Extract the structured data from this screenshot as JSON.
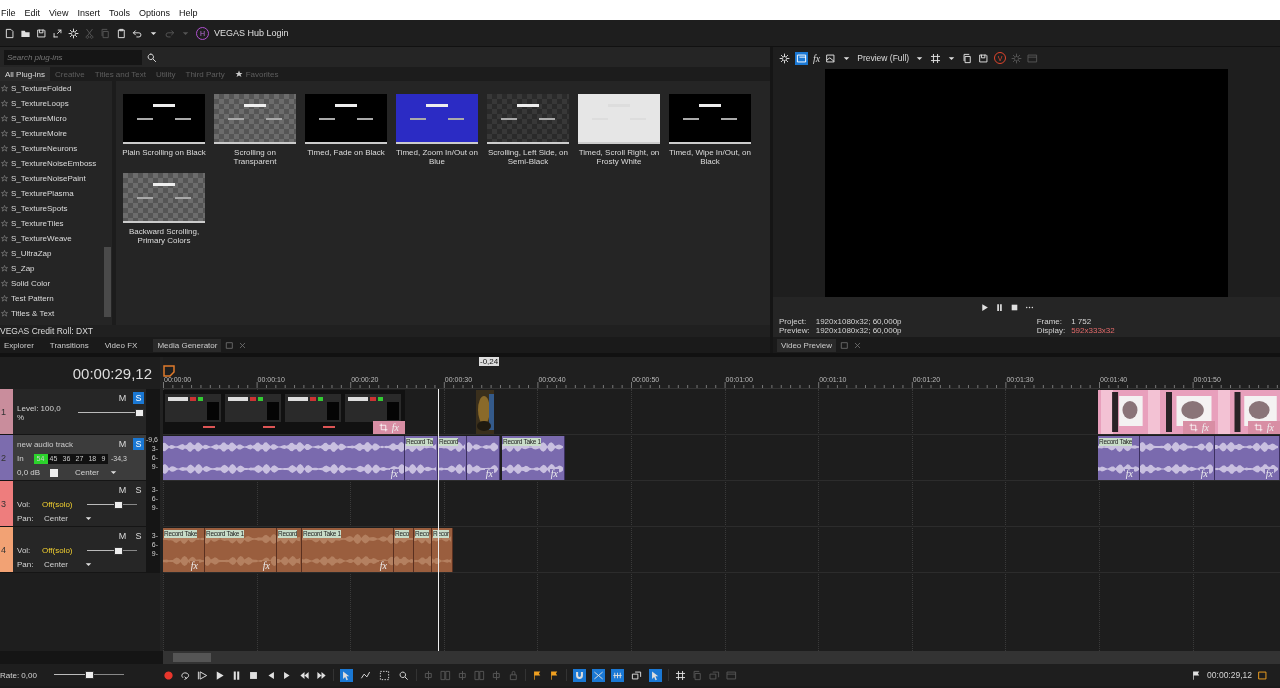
{
  "menu": [
    "File",
    "Edit",
    "View",
    "Insert",
    "Tools",
    "Options",
    "Help"
  ],
  "toolbar": {
    "buttons": [
      {
        "kind": "document",
        "disabled": false
      },
      {
        "kind": "folder",
        "disabled": false
      },
      {
        "kind": "save",
        "disabled": false
      },
      {
        "kind": "expand",
        "disabled": false
      },
      {
        "kind": "settings",
        "disabled": false
      },
      {
        "kind": "scissors",
        "disabled": true
      },
      {
        "kind": "copy",
        "disabled": true
      },
      {
        "kind": "clipboard",
        "disabled": false
      },
      {
        "kind": "undo",
        "disabled": false
      },
      {
        "kind": "caret",
        "disabled": false
      },
      {
        "kind": "redo",
        "disabled": true
      },
      {
        "kind": "caret",
        "disabled": true
      }
    ],
    "hub_badge": "H",
    "hub_label": "VEGAS Hub Login"
  },
  "media_generator": {
    "search": {
      "placeholder": "Search plug-ins"
    },
    "tabs": [
      {
        "label": "All Plug-ins",
        "selected": true
      },
      {
        "label": "Creative",
        "selected": false
      },
      {
        "label": "Titles and Text",
        "selected": false
      },
      {
        "label": "Utility",
        "selected": false
      },
      {
        "label": "Third Party",
        "selected": false
      },
      {
        "label": "Favorites",
        "selected": false
      }
    ],
    "plugins": [
      "S_TextureFolded",
      "S_TextureLoops",
      "S_TextureMicro",
      "S_TextureMoire",
      "S_TextureNeurons",
      "S_TextureNoiseEmboss",
      "S_TextureNoisePaint",
      "S_TexturePlasma",
      "S_TextureSpots",
      "S_TextureTiles",
      "S_TextureWeave",
      "S_UltraZap",
      "S_Zap",
      "Solid Color",
      "Test Pattern",
      "Titles & Text"
    ],
    "presets": [
      {
        "name": "Plain Scrolling on Black",
        "kind": "black"
      },
      {
        "name": "Scrolling on Transparent",
        "kind": "checker"
      },
      {
        "name": "Timed, Fade on Black",
        "kind": "black"
      },
      {
        "name": "Timed, Zoom In/Out on Blue",
        "kind": "blue"
      },
      {
        "name": "Scrolling, Left Side, on Semi-Black",
        "kind": "dark-checker"
      },
      {
        "name": "Timed, Scroll Right, on Frosty White",
        "kind": "white"
      },
      {
        "name": "Timed, Wipe In/Out, on Black",
        "kind": "black"
      },
      {
        "name": "Backward Scrolling, Primary Colors",
        "kind": "checker"
      }
    ],
    "status": "VEGAS Credit Roll: DXT"
  },
  "dock_tabs": [
    {
      "label": "Explorer",
      "selected": false
    },
    {
      "label": "Transitions",
      "selected": false
    },
    {
      "label": "Video FX",
      "selected": false
    },
    {
      "label": "Media Generator",
      "selected": true
    }
  ],
  "preview": {
    "split_view_on": true,
    "fx": "fx",
    "quality": "Preview (Full)",
    "badge": "V",
    "project_label": "Project:",
    "project": "1920x1080x32; 60,000p",
    "preview_label": "Preview:",
    "preview_value": "1920x1080x32; 60,000p",
    "frame_label": "Frame:",
    "frame": "1 752",
    "display_label": "Display:",
    "display": "592x333x32",
    "tab": {
      "label": "Video Preview",
      "selected": true
    }
  },
  "timeline": {
    "time": "00:00:29,12",
    "marker": "-0,24",
    "ruler": [
      "00:00:00",
      "00:00:10",
      "00:00:20",
      "00:00:30",
      "00:00:40",
      "00:00:50",
      "00:01:00",
      "00:01:10",
      "00:01:20",
      "00:01:30",
      "00:01:40",
      "00:01:50"
    ],
    "tracks": [
      {
        "kind": "video",
        "number": "1",
        "color": "#c98d9c",
        "selected": false,
        "mute": "M",
        "solo": "S",
        "solo_on": true,
        "level_label": "Level: 100,0 %",
        "level": 1.0,
        "clips": [
          {
            "kind": "screen",
            "fx": "fx"
          },
          {
            "kind": "painting"
          },
          {
            "kind": "pink"
          },
          {
            "kind": "pink",
            "fx": "fx"
          },
          {
            "kind": "pink",
            "fx": "fx"
          }
        ]
      },
      {
        "kind": "audio-input",
        "number": "2",
        "color": "#7c6cae",
        "selected": true,
        "name": "new audio track",
        "mute": "M",
        "solo": "S",
        "solo_on": true,
        "peak": "-9,6",
        "in_label": "In",
        "meter_ticks": [
          "54",
          "45",
          "36",
          "27",
          "18",
          "9"
        ],
        "meter_reading": "-34,3",
        "level": 0.19,
        "gain": "0,0 dB",
        "pan": "Center",
        "scale": [
          "3-",
          "6-",
          "9-"
        ],
        "clips": [
          {
            "fx": "fx"
          },
          {
            "label": "Record Ta"
          },
          {
            "label": "Record"
          },
          {
            "fx": "fx"
          },
          {
            "label": "Record Take 1",
            "fx": "fx"
          },
          {
            "label": "Record Take",
            "fx": "fx"
          },
          {
            "fx": "fx"
          },
          {
            "fx": "fx"
          }
        ]
      },
      {
        "kind": "audio",
        "number": "3",
        "color": "#ee7d7d",
        "selected": false,
        "mute": "M",
        "solo": "S",
        "solo_on": false,
        "vol_label": "Vol:",
        "vol": "Off(solo)",
        "pan_label": "Pan:",
        "pan": "Center",
        "level": 0.62,
        "scale": [
          "3-",
          "6-",
          "9-"
        ]
      },
      {
        "kind": "audio",
        "number": "4",
        "color": "#f2a274",
        "selected": false,
        "mute": "M",
        "solo": "S",
        "solo_on": false,
        "vol_label": "Vol:",
        "vol": "Off(solo)",
        "pan_label": "Pan:",
        "pan": "Center",
        "level": 0.62,
        "scale": [
          "3-",
          "6-",
          "9-"
        ],
        "clips": [
          {
            "label": "Record Take",
            "fx": "fx"
          },
          {
            "label": "Record Take 1",
            "fx": "fx"
          },
          {
            "label": "Record"
          },
          {
            "label": "Record Take 1",
            "fx": "fx"
          },
          {
            "label": "Reco"
          },
          {
            "label": "Reco"
          },
          {
            "label": "Recor"
          }
        ]
      }
    ]
  },
  "bottom": {
    "rate": {
      "label": "Rate: 0,00",
      "level": 0.5
    },
    "tools": [
      {
        "kind": "pointer",
        "selected": true
      },
      {
        "kind": "envelope",
        "selected": false
      },
      {
        "kind": "selection",
        "selected": false
      },
      {
        "kind": "zoom",
        "selected": false
      }
    ],
    "switches": [
      {
        "kind": "magnet",
        "on": true
      },
      {
        "kind": "crossfade",
        "on": true
      },
      {
        "kind": "ripple",
        "on": true
      },
      {
        "kind": "layers",
        "on": false
      },
      {
        "kind": "pointer",
        "on": true
      }
    ],
    "time": "00:00:29,12"
  }
}
